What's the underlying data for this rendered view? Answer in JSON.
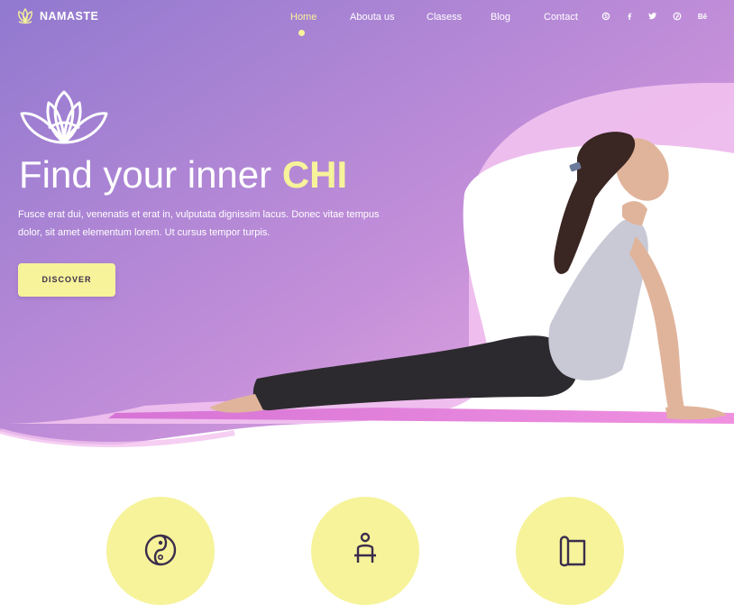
{
  "brand": {
    "name": "NAMASTE",
    "icon": "lotus-icon"
  },
  "nav": {
    "items": [
      {
        "label": "Home",
        "active": true
      },
      {
        "label": "Abouta us",
        "active": false
      },
      {
        "label": "Clasess",
        "active": false
      },
      {
        "label": "Blog",
        "active": false
      },
      {
        "label": "Contact",
        "active": false
      }
    ],
    "social": [
      "skype-icon",
      "facebook-icon",
      "twitter-icon",
      "pinterest-icon",
      "behance-icon"
    ],
    "behance_label": "Bē"
  },
  "hero": {
    "headline_prefix": "Find your inner ",
    "headline_highlight": "CHI",
    "body": "Fusce erat dui, venenatis et erat in, vulputata dignissim lacus. Donec vitae tempus dolor, sit amet elementum lorem. Ut cursus tempor turpis.",
    "cta_label": "DISCOVER"
  },
  "features": {
    "icons": [
      "yin-yang-icon",
      "person-icon",
      "yoga-mat-icon"
    ]
  },
  "colors": {
    "accent": "#f6f39a",
    "gradient_start": "#9b7fd4",
    "gradient_end": "#e6a2e0",
    "text_dark": "#3b2d4c"
  }
}
